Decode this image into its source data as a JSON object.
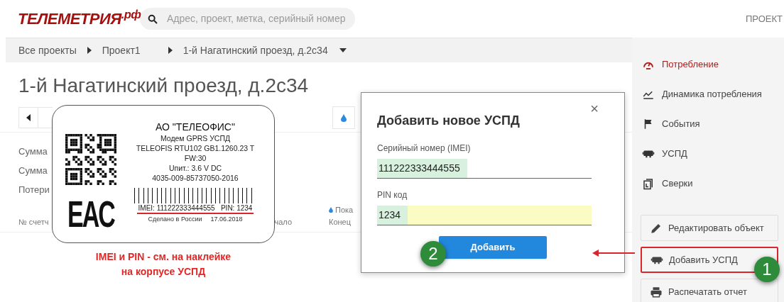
{
  "header": {
    "logo": "ТЕЛЕМЕТРИЯ$^{.рф}$",
    "search": {
      "placeholder": "Адрес, проект, метка, серийный номер"
    },
    "nav": [
      "ПРОЕКТ"
    ]
  },
  "breadcrumbs": [
    {
      "label": "Все проекты"
    },
    {
      "label": "Проект1"
    },
    {
      "label": "1-й Нагатинский проезд, д.2с34"
    }
  ],
  "page_title": "1-й Нагатинский проезд, д.2с34",
  "summary_rows": [
    "Сумма",
    "Сумма",
    "Потери"
  ],
  "table_columns": [
    "№ счетч",
    "чало"
  ],
  "meter_column": [
    "Пока",
    "Конец"
  ],
  "sidebar": {
    "items": [
      {
        "label": "Потребление",
        "selected": true,
        "kind": "gauge"
      },
      {
        "label": "Динамика потребления",
        "selected": false,
        "kind": "chart"
      },
      {
        "label": "События",
        "selected": false,
        "kind": "flag"
      },
      {
        "label": "УСПД",
        "selected": false,
        "kind": "device"
      },
      {
        "label": "Сверки",
        "selected": false,
        "kind": "copies"
      }
    ],
    "buttons": [
      {
        "label": "Редактировать объект",
        "highlighted": false,
        "kind": "pencil"
      },
      {
        "label": "Добавить УСПД",
        "highlighted": true,
        "kind": "device"
      },
      {
        "label": "Распечатать отчет",
        "highlighted": false,
        "kind": "printer"
      }
    ]
  },
  "sticker": {
    "company": "АО \"ТЕЛЕОФИС\"",
    "lines": [
      "Модем GPRS УСПД",
      "TELEOFIS RTU102 GB1.1260.23 T",
      "FW:30",
      "Uпит.: 3.6 V DC",
      "4035-009-85737050-2016"
    ],
    "mark": "EAC",
    "barcode_text": "IMEI: 111222333444555   PIN: 1234",
    "made_in": "Сделано в России",
    "date": "17.06.2018"
  },
  "caption": [
    "IMEI и PIN - см. на наклейке",
    "на корпусе УСПД"
  ],
  "dialog": {
    "title": "Добавить новое УСПД",
    "close": "×",
    "fields": [
      {
        "label": "Серийный номер (IMEI)",
        "value": "111222333444555",
        "autofilled": false
      },
      {
        "label": "PIN код",
        "value": "1234",
        "autofilled": true
      }
    ],
    "submit": "Добавить"
  },
  "callouts": [
    "1",
    "2"
  ]
}
